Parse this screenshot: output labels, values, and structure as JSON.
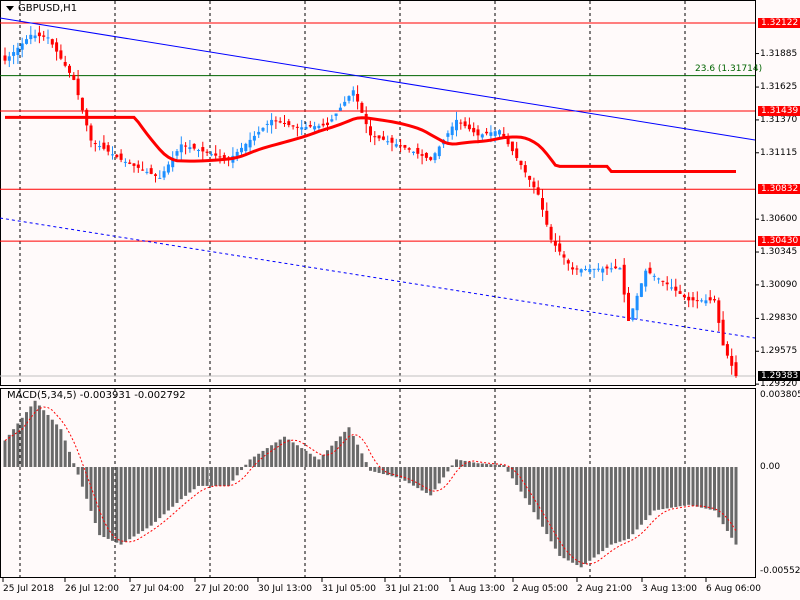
{
  "chart_title": "GBPUSD,H1",
  "indicator_label": "MACD(5,34,5) -0.003931 -0.002792",
  "fib_label": "23.6 (1.31714)",
  "price_axis": [
    "1.31885",
    "1.31625",
    "1.31370",
    "1.31115",
    "1.30600",
    "1.30345",
    "1.30090",
    "1.29830",
    "1.29575",
    "1.29320"
  ],
  "price_tags": [
    "1.32122",
    "1.31439",
    "1.30832",
    "1.30430"
  ],
  "current_price": "1.29383",
  "macd_axis": [
    "0.003805",
    "0.00",
    "-0.005521"
  ],
  "time_axis": [
    "25 Jul 2018",
    "26 Jul 12:00",
    "27 Jul 04:00",
    "27 Jul 20:00",
    "30 Jul 13:00",
    "31 Jul 05:00",
    "31 Jul 21:00",
    "1 Aug 13:00",
    "2 Aug 05:00",
    "2 Aug 21:00",
    "3 Aug 13:00",
    "6 Aug 06:00"
  ],
  "colors": {
    "bull": "#1e90ff",
    "bear": "#ff0000",
    "ma": "#ff0000",
    "trend": "#0000ff",
    "fib": "#006400",
    "hist": "#696969",
    "signal": "#ff0000"
  },
  "chart_data": {
    "type": "candlestick",
    "symbol": "GBPUSD",
    "timeframe": "H1",
    "horizontal_levels": [
      1.32122,
      1.31439,
      1.30832,
      1.3043
    ],
    "fib_level": 1.31714,
    "current": 1.29383,
    "price_range": [
      1.2932,
      1.323
    ],
    "close_keypoints": [
      [
        0,
        1.3183
      ],
      [
        6,
        1.3203
      ],
      [
        10,
        1.3201
      ],
      [
        16,
        1.3168
      ],
      [
        20,
        1.3121
      ],
      [
        27,
        1.3106
      ],
      [
        36,
        1.3092
      ],
      [
        41,
        1.3118
      ],
      [
        52,
        1.3106
      ],
      [
        62,
        1.3137
      ],
      [
        68,
        1.3131
      ],
      [
        75,
        1.3133
      ],
      [
        81,
        1.316
      ],
      [
        85,
        1.3125
      ],
      [
        92,
        1.3117
      ],
      [
        99,
        1.3106
      ],
      [
        105,
        1.3137
      ],
      [
        110,
        1.3125
      ],
      [
        115,
        1.3129
      ],
      [
        120,
        1.3102
      ],
      [
        124,
        1.3079
      ],
      [
        127,
        1.3044
      ],
      [
        132,
        1.3021
      ],
      [
        143,
        1.3022
      ],
      [
        145,
        1.2981
      ],
      [
        149,
        1.302
      ],
      [
        153,
        1.3012
      ],
      [
        159,
        1.2997
      ],
      [
        165,
        1.2997
      ],
      [
        167,
        1.2962
      ],
      [
        170,
        1.29383
      ]
    ],
    "macd_range": [
      -0.005521,
      0.003805
    ],
    "macd_keypoints": [
      [
        0,
        0.0014
      ],
      [
        7,
        0.0035
      ],
      [
        13,
        0.002
      ],
      [
        17,
        -0.0004
      ],
      [
        22,
        -0.0036
      ],
      [
        27,
        -0.0041
      ],
      [
        34,
        -0.0031
      ],
      [
        41,
        -0.0017
      ],
      [
        45,
        -0.001
      ],
      [
        52,
        -0.001
      ],
      [
        57,
        0.0004
      ],
      [
        65,
        0.0016
      ],
      [
        73,
        0.0004
      ],
      [
        80,
        0.0021
      ],
      [
        85,
        -0.0002
      ],
      [
        92,
        -0.0006
      ],
      [
        99,
        -0.0015
      ],
      [
        105,
        0.0004
      ],
      [
        110,
        0.0002
      ],
      [
        116,
        0.0001
      ],
      [
        122,
        -0.002
      ],
      [
        129,
        -0.0047
      ],
      [
        134,
        -0.0053
      ],
      [
        141,
        -0.0041
      ],
      [
        145,
        -0.0038
      ],
      [
        151,
        -0.0023
      ],
      [
        159,
        -0.002
      ],
      [
        165,
        -0.0023
      ],
      [
        170,
        -0.0041
      ]
    ]
  }
}
